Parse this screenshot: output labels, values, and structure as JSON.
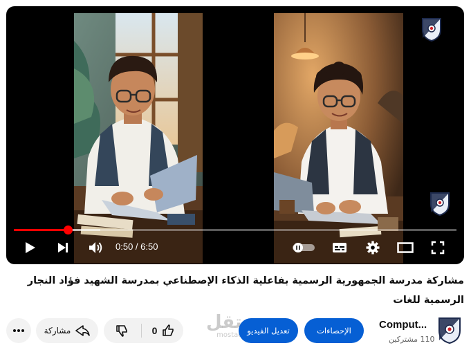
{
  "player": {
    "current_time": "0:50",
    "duration": "6:50",
    "time_display": "0:50 / 6:50",
    "progress_fraction": 0.122,
    "buffered_fraction": 0.195
  },
  "video": {
    "title": "مشاركة مدرسة الجمهورية الرسمية بفاعلية الذكاء الإصطناعي بمدرسة الشهيد فؤاد النجار الرسمية للغات"
  },
  "actions": {
    "like_count": "0",
    "share_label": "مشاركة",
    "stats_label": "الإحصاءات",
    "edit_label": "تعديل الفيديو"
  },
  "channel": {
    "name": "Comput...",
    "subscribers": "110 مشتركين"
  },
  "watermark": {
    "brand": "مستقل",
    "domain": "mostaql.com"
  },
  "colors": {
    "accent_red": "#ff0000",
    "button_blue": "#065fd4",
    "pill_gray": "#f2f2f2"
  },
  "icons": [
    "play-icon",
    "next-icon",
    "volume-icon",
    "autoplay-toggle-icon",
    "subtitles-icon",
    "settings-icon",
    "theater-mode-icon",
    "fullscreen-icon",
    "like-icon",
    "dislike-icon",
    "share-icon",
    "more-icon",
    "channel-shield-icon"
  ]
}
